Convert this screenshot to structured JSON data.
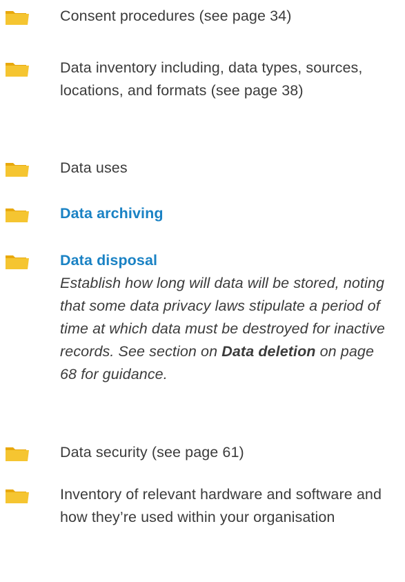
{
  "items": [
    {
      "text": "Consent procedures (see page 34)"
    },
    {
      "text": "Data inventory including, data types, sources, locations, and formats (see page 38)"
    },
    {
      "text": "Data uses"
    },
    {
      "title": "Data archiving"
    },
    {
      "title": "Data disposal",
      "desc_part1": "Establish how long will data will be stored, noting that some data privacy laws stipulate a period of time at which data must be destroyed for inactive records. See section on ",
      "desc_bold": "Data deletion",
      "desc_part2": " on page 68 for guidance."
    },
    {
      "text": "Data security (see page 61)"
    },
    {
      "text": "Inventory of relevant hardware and software and how they’re used within your organisation"
    }
  ],
  "colors": {
    "folder_body": "#f5c531",
    "folder_tab": "#e8a80d",
    "accent_blue": "#1a82c4",
    "body_text": "#3b3b3b"
  },
  "icon": "folder-icon"
}
